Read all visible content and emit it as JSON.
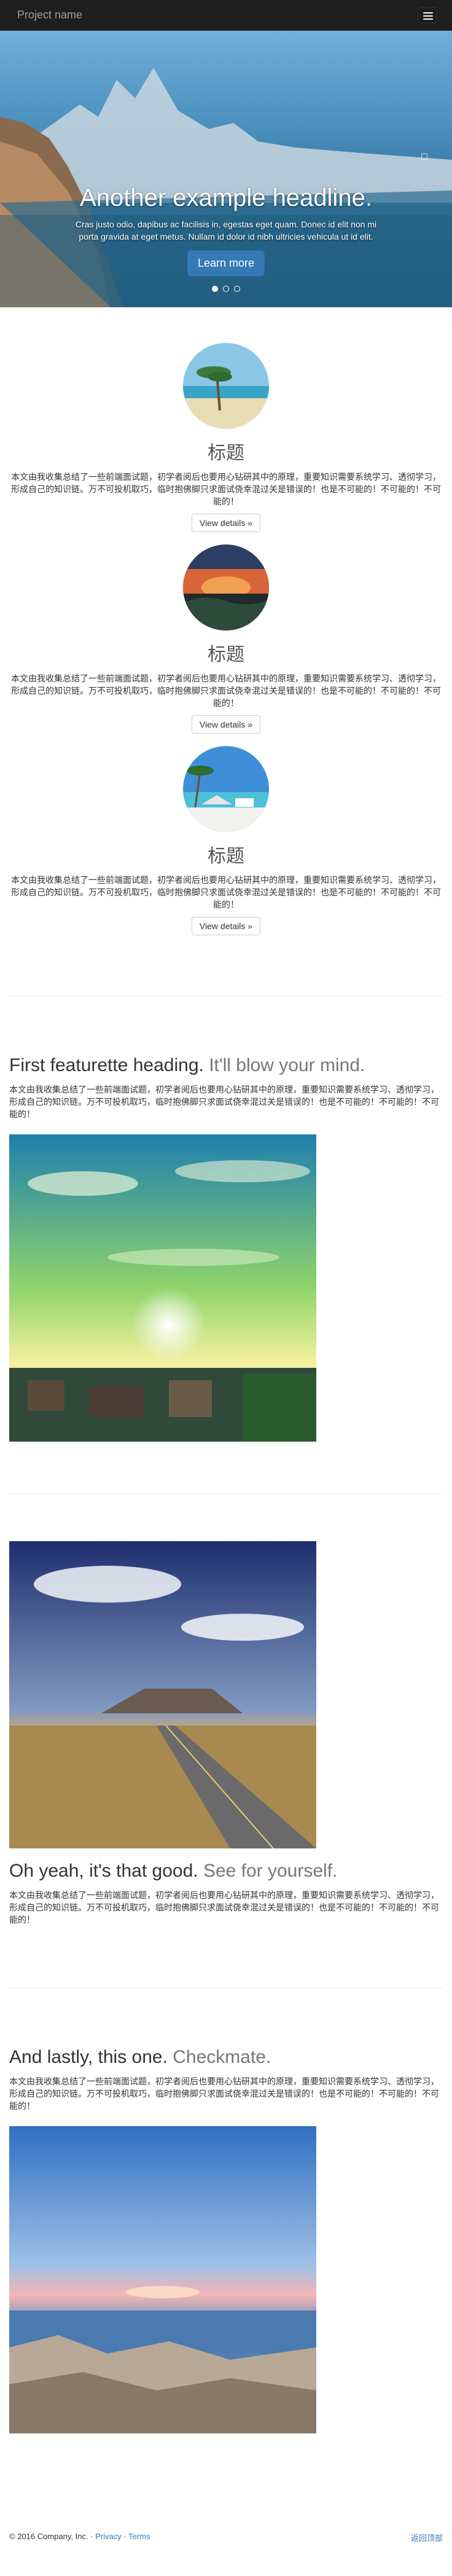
{
  "navbar": {
    "brand": "Project name",
    "menu_icon": "hamburger-icon"
  },
  "hero": {
    "headline": "Another example headline.",
    "description": "Cras justo odio, dapibus ac facilisis in, egestas eget quam. Donec id elit non mi porta gravida at eget metus. Nullam id dolor id nibh ultricies vehicula ut id elit.",
    "button": "Learn more",
    "slides": 3,
    "active_slide": 1
  },
  "marketing": [
    {
      "heading": "标题",
      "body": "本文由我收集总结了一些前端面试题，初学者阅后也要用心钻研其中的原理，重要知识需要系统学习、透彻学习，形成自己的知识链。万不可投机取巧，临时抱佛脚只求面试侥幸混过关是错误的！也是不可能的！不可能的！不可能的！",
      "button": "View details »"
    },
    {
      "heading": "标题",
      "body": "本文由我收集总结了一些前端面试题，初学者阅后也要用心钻研其中的原理，重要知识需要系统学习、透彻学习，形成自己的知识链。万不可投机取巧，临时抱佛脚只求面试侥幸混过关是错误的！也是不可能的！不可能的！不可能的！",
      "button": "View details »"
    },
    {
      "heading": "标题",
      "body": "本文由我收集总结了一些前端面试题，初学者阅后也要用心钻研其中的原理，重要知识需要系统学习、透彻学习，形成自己的知识链。万不可投机取巧，临时抱佛脚只求面试侥幸混过关是错误的！也是不可能的！不可能的！不可能的！",
      "button": "View details »"
    }
  ],
  "featurettes": [
    {
      "heading": "First featurette heading.",
      "muted": "It'll blow your mind.",
      "body": "本文由我收集总结了一些前端面试题，初学者阅后也要用心钻研其中的原理，重要知识需要系统学习、透彻学习，形成自己的知识链。万不可投机取巧，临时抱佛脚只求面试侥幸混过关是错误的！也是不可能的！不可能的！不可能的！"
    },
    {
      "heading": "Oh yeah, it's that good.",
      "muted": "See for yourself.",
      "body": "本文由我收集总结了一些前端面试题，初学者阅后也要用心钻研其中的原理，重要知识需要系统学习、透彻学习，形成自己的知识链。万不可投机取巧，临时抱佛脚只求面试侥幸混过关是错误的！也是不可能的！不可能的！不可能的！"
    },
    {
      "heading": "And lastly, this one.",
      "muted": "Checkmate.",
      "body": "本文由我收集总结了一些前端面试题，初学者阅后也要用心钻研其中的原理，重要知识需要系统学习、透彻学习，形成自己的知识链。万不可投机取巧，临时抱佛脚只求面试侥幸混过关是错误的！也是不可能的！不可能的！不可能的！"
    }
  ],
  "footer": {
    "copyright": "© 2016 Company, Inc. ·",
    "privacy": "Privacy",
    "sep": "·",
    "terms": "Terms",
    "back_to_top": "返回顶部"
  },
  "colors": {
    "navbar": "#1e1e1e",
    "primary": "#337ab7",
    "link": "#337ab7"
  }
}
